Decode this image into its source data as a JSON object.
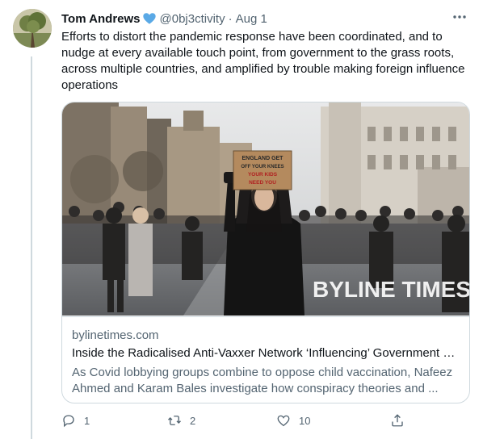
{
  "tweet": {
    "author_name": "Tom Andrews",
    "verified_heart": "💙",
    "handle": "@0bj3ctivity",
    "separator": "·",
    "date": "Aug 1",
    "more_icon": "ellipsis-icon",
    "text": "Efforts to distort the pandemic response have been coordinated, and to nudge at every available touch point, from government to the grass roots, across multiple countries, and amplified by trouble making foreign influence operations"
  },
  "card": {
    "domain": "bylinetimes.com",
    "title": "Inside the Radicalised Anti-Vaxxer Network ‘Influencing’ Government V...",
    "description": "As Covid lobbying groups combine to oppose child vaccination, Nafeez Ahmed and Karam Bales investigate how conspiracy theories and ...",
    "image": {
      "sign_text": [
        "ENGLAND GET",
        "OFF YOUR KNEES",
        "YOUR KIDS",
        "NEED YOU"
      ],
      "watermark": "BYLINE TIMES"
    }
  },
  "actions": {
    "reply": {
      "icon": "reply-icon",
      "count": "1"
    },
    "retweet": {
      "icon": "retweet-icon",
      "count": "2"
    },
    "like": {
      "icon": "heart-icon",
      "count": "10"
    },
    "share": {
      "icon": "share-icon"
    }
  },
  "colors": {
    "text": "#0f1419",
    "secondary": "#536471",
    "border": "#cfd9de",
    "verified_heart": "#5aa9e6"
  }
}
